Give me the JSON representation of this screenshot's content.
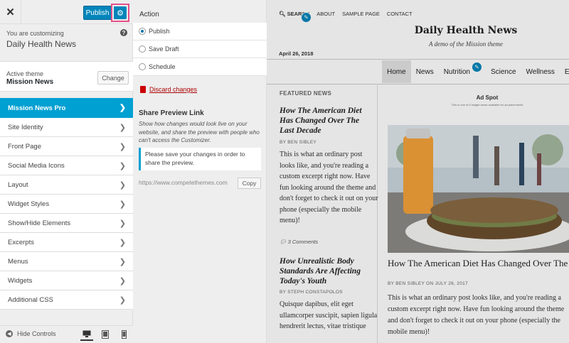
{
  "sidebar": {
    "publish_label": "Publish",
    "customizing_label": "You are customizing",
    "site_name": "Daily Health News",
    "active_theme_label": "Active theme",
    "theme_name": "Mission News",
    "change_label": "Change",
    "menu": [
      {
        "label": "Mission News Pro",
        "active": true
      },
      {
        "label": "Site Identity"
      },
      {
        "label": "Front Page"
      },
      {
        "label": "Social Media Icons"
      },
      {
        "label": "Layout"
      },
      {
        "label": "Widget Styles"
      },
      {
        "label": "Show/Hide Elements"
      },
      {
        "label": "Excerpts"
      },
      {
        "label": "Menus"
      },
      {
        "label": "Widgets"
      },
      {
        "label": "Additional CSS"
      }
    ],
    "hide_controls_label": "Hide Controls",
    "accent_color": "#00a0d2"
  },
  "publish_panel": {
    "action_title": "Action",
    "options": [
      "Publish",
      "Save Draft",
      "Schedule"
    ],
    "selected": "Publish",
    "discard_label": "Discard changes",
    "share_title": "Share Preview Link",
    "share_desc": "Show how changes would look live on your website, and share the preview with people who can't access the Customizer.",
    "share_note": "Please save your changes in order to share the preview.",
    "share_url": "https://www.competethemes.com",
    "copy_label": "Copy"
  },
  "preview": {
    "top_nav": [
      "SEARCH",
      "ABOUT",
      "SAMPLE PAGE",
      "CONTACT"
    ],
    "date": "April 26, 2018",
    "site_title": "Daily Health News",
    "tagline": "A demo of the Mission theme",
    "main_nav": [
      "Home",
      "News",
      "Nutrition",
      "Science",
      "Wellness",
      "Exe"
    ],
    "featured_label": "FEATURED NEWS",
    "post1": {
      "title": "How The American Diet Has Changed Over The Last Decade",
      "byline": "BY BEN SIBLEY",
      "excerpt": "This is what an ordinary post looks like, and you're reading a custom excerpt right now. Have fun looking around the theme and don't forget to check it out on your phone (especially the mobile menu)!",
      "comments": "3 Comments"
    },
    "post2": {
      "title": "How Unrealistic Body Standards Are Affecting Today's Youth",
      "byline": "BY STEPH CONSTAPOLOS",
      "excerpt": "Quisque dapibus, elit eget ullamcorper suscipit, sapien ligula hendrerit lectus, vitae tristique"
    },
    "ad_title": "Ad Spot",
    "ad_sub": "This is one of 5 widget areas available for ad placements",
    "big_post": {
      "title": "How The American Diet Has Changed Over The Last Decade",
      "byline": "BY BEN SIBLEY ON JULY 26, 2017",
      "excerpt": "This is what an ordinary post looks like, and you're reading a custom excerpt right now. Have fun looking around the theme and don't forget to check it out on your phone (especially the mobile menu)!"
    }
  }
}
